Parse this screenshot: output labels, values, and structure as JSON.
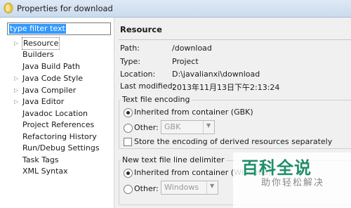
{
  "window": {
    "title": "Properties for download",
    "icon": "eclipse-app-icon"
  },
  "filter": {
    "placeholder": "type filter text"
  },
  "tree": [
    {
      "label": "Resource",
      "expandable": true,
      "selected": true
    },
    {
      "label": "Builders",
      "expandable": false
    },
    {
      "label": "Java Build Path",
      "expandable": false
    },
    {
      "label": "Java Code Style",
      "expandable": true
    },
    {
      "label": "Java Compiler",
      "expandable": true
    },
    {
      "label": "Java Editor",
      "expandable": true
    },
    {
      "label": "Javadoc Location",
      "expandable": false
    },
    {
      "label": "Project References",
      "expandable": false
    },
    {
      "label": "Refactoring History",
      "expandable": false
    },
    {
      "label": "Run/Debug Settings",
      "expandable": false
    },
    {
      "label": "Task Tags",
      "expandable": false
    },
    {
      "label": "XML Syntax",
      "expandable": false
    }
  ],
  "resource": {
    "heading": "Resource",
    "props": [
      {
        "label": "Path:",
        "value": "/download"
      },
      {
        "label": "Type:",
        "value": "Project"
      },
      {
        "label": "Location:",
        "value": "D:\\javalianxi\\download"
      },
      {
        "label": "Last modified:",
        "value": "2013年11月13日下午2:13:24"
      }
    ]
  },
  "encoding": {
    "title": "Text file encoding",
    "inherited": "Inherited from container (GBK)",
    "other": "Other:",
    "other_value": "GBK",
    "store": "Store the encoding of derived resources separately"
  },
  "delimiter": {
    "title": "New text file line delimiter",
    "inherited": "Inherited from container (Windows)",
    "other": "Other:",
    "other_value": "Windows"
  },
  "watermark": {
    "main": "百科全说",
    "sub": "助你轻松解决"
  }
}
